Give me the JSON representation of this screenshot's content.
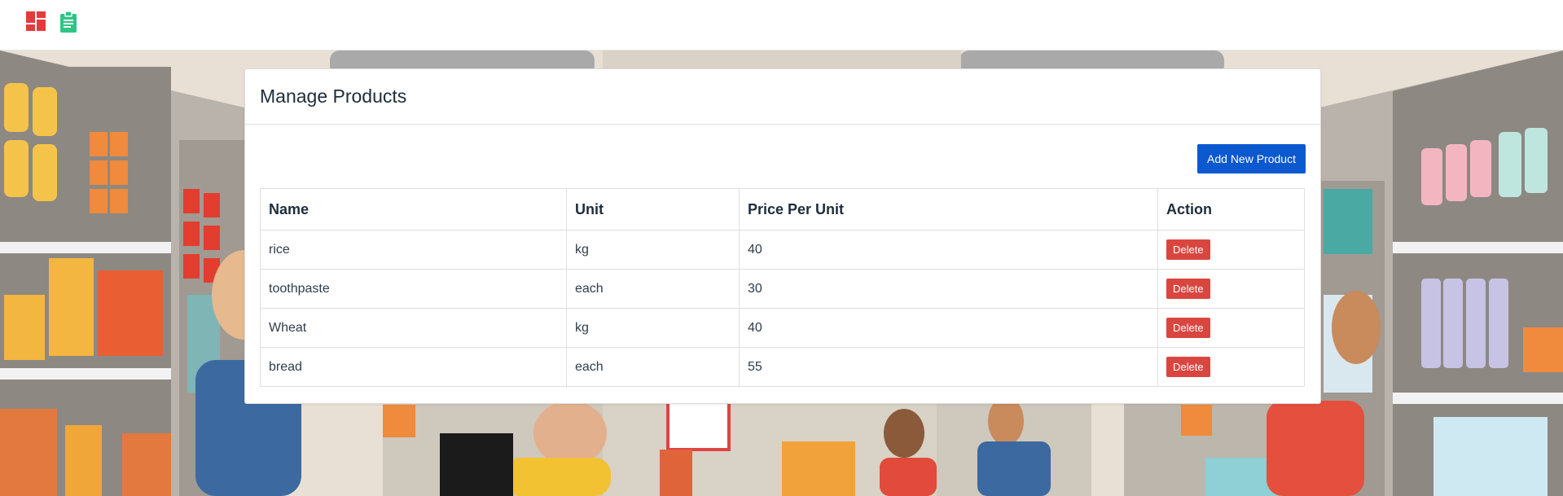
{
  "navbar": {
    "icons": [
      {
        "name": "dashboard-icon",
        "color": "#e33b3b"
      },
      {
        "name": "clipboard-icon",
        "color": "#2fc485"
      }
    ]
  },
  "card": {
    "title": "Manage Products",
    "add_button_label": "Add New Product"
  },
  "table": {
    "headers": [
      "Name",
      "Unit",
      "Price Per Unit",
      "Action"
    ],
    "rows": [
      {
        "name": "rice",
        "unit": "kg",
        "price": "40",
        "action": "Delete"
      },
      {
        "name": "toothpaste",
        "unit": "each",
        "price": "30",
        "action": "Delete"
      },
      {
        "name": "Wheat",
        "unit": "kg",
        "price": "40",
        "action": "Delete"
      },
      {
        "name": "bread",
        "unit": "each",
        "price": "55",
        "action": "Delete"
      }
    ]
  },
  "colors": {
    "primary": "#0b58cf",
    "danger": "#d9463f",
    "text": "#1e2d3b"
  }
}
